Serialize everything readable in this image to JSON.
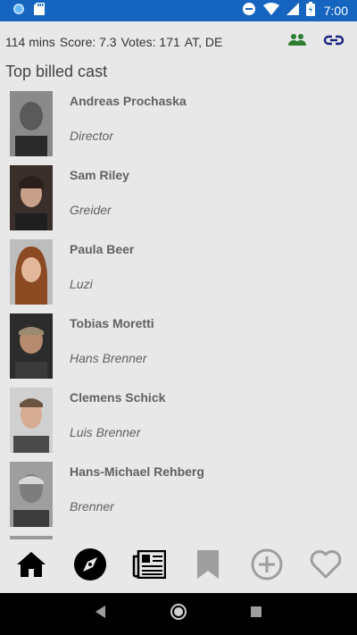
{
  "status_bar": {
    "time": "7:00",
    "bg_color": "#1565c0"
  },
  "info": {
    "runtime": "114 mins",
    "score": "Score: 7.3",
    "votes": "Votes: 171",
    "countries": "AT, DE",
    "icons": [
      "people-icon",
      "link-icon"
    ],
    "accent_green": "#2e7d32",
    "accent_blue": "#1a237e"
  },
  "section_title": "Top billed cast",
  "cast": [
    {
      "name": "Andreas Prochaska",
      "role": "Director"
    },
    {
      "name": "Sam Riley",
      "role": "Greider"
    },
    {
      "name": "Paula Beer",
      "role": "Luzi"
    },
    {
      "name": "Tobias Moretti",
      "role": "Hans Brenner"
    },
    {
      "name": "Clemens Schick",
      "role": "Luis Brenner"
    },
    {
      "name": "Hans-Michael Rehberg",
      "role": "Brenner"
    }
  ],
  "bottom_nav": {
    "items": [
      "home-icon",
      "explore-icon",
      "news-icon",
      "bookmark-icon",
      "add-icon",
      "favorite-icon"
    ],
    "active_color": "#000000",
    "inactive_color": "#9e9e9e"
  },
  "system_nav": [
    "back-icon",
    "home-circle-icon",
    "recents-icon"
  ]
}
